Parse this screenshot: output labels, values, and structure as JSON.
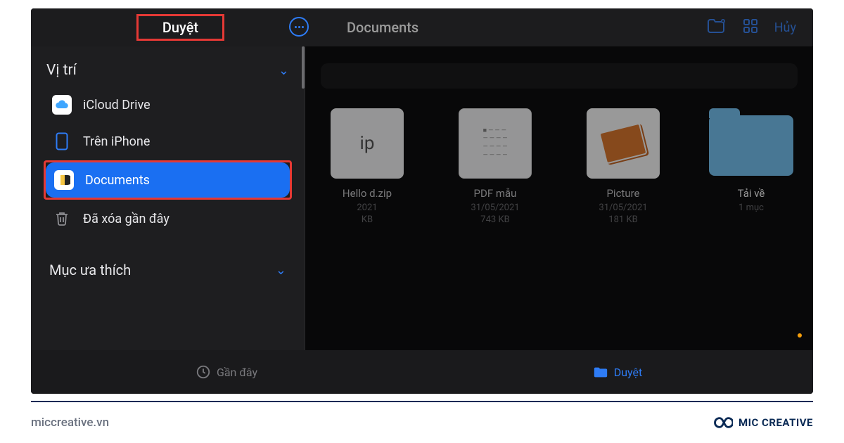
{
  "topbar": {
    "browse_title": "Duyệt",
    "main_title": "Documents",
    "cancel": "Hủy"
  },
  "sidebar": {
    "locations_title": "Vị trí",
    "items": [
      {
        "label": "iCloud Drive"
      },
      {
        "label": "Trên iPhone"
      },
      {
        "label": "Documents"
      },
      {
        "label": "Đã xóa gần đây"
      }
    ],
    "favourites_title": "Mục ưa thích"
  },
  "files": [
    {
      "name": "Hello d.zip",
      "date": "2021",
      "size": "KB",
      "thumb_text": "ip",
      "kind": "zip"
    },
    {
      "name": "PDF mẫu",
      "date": "31/05/2021",
      "size": "743 KB",
      "kind": "pdf"
    },
    {
      "name": "Picture",
      "date": "31/05/2021",
      "size": "181 KB",
      "kind": "pic"
    },
    {
      "name": "Tải về",
      "date": "1 mục",
      "size": "",
      "kind": "folder",
      "selected": true
    }
  ],
  "tabs": {
    "recent": "Gần đây",
    "browse": "Duyệt"
  },
  "footer": {
    "site": "miccreative.vn",
    "brand": "MIC CREATIVE"
  }
}
